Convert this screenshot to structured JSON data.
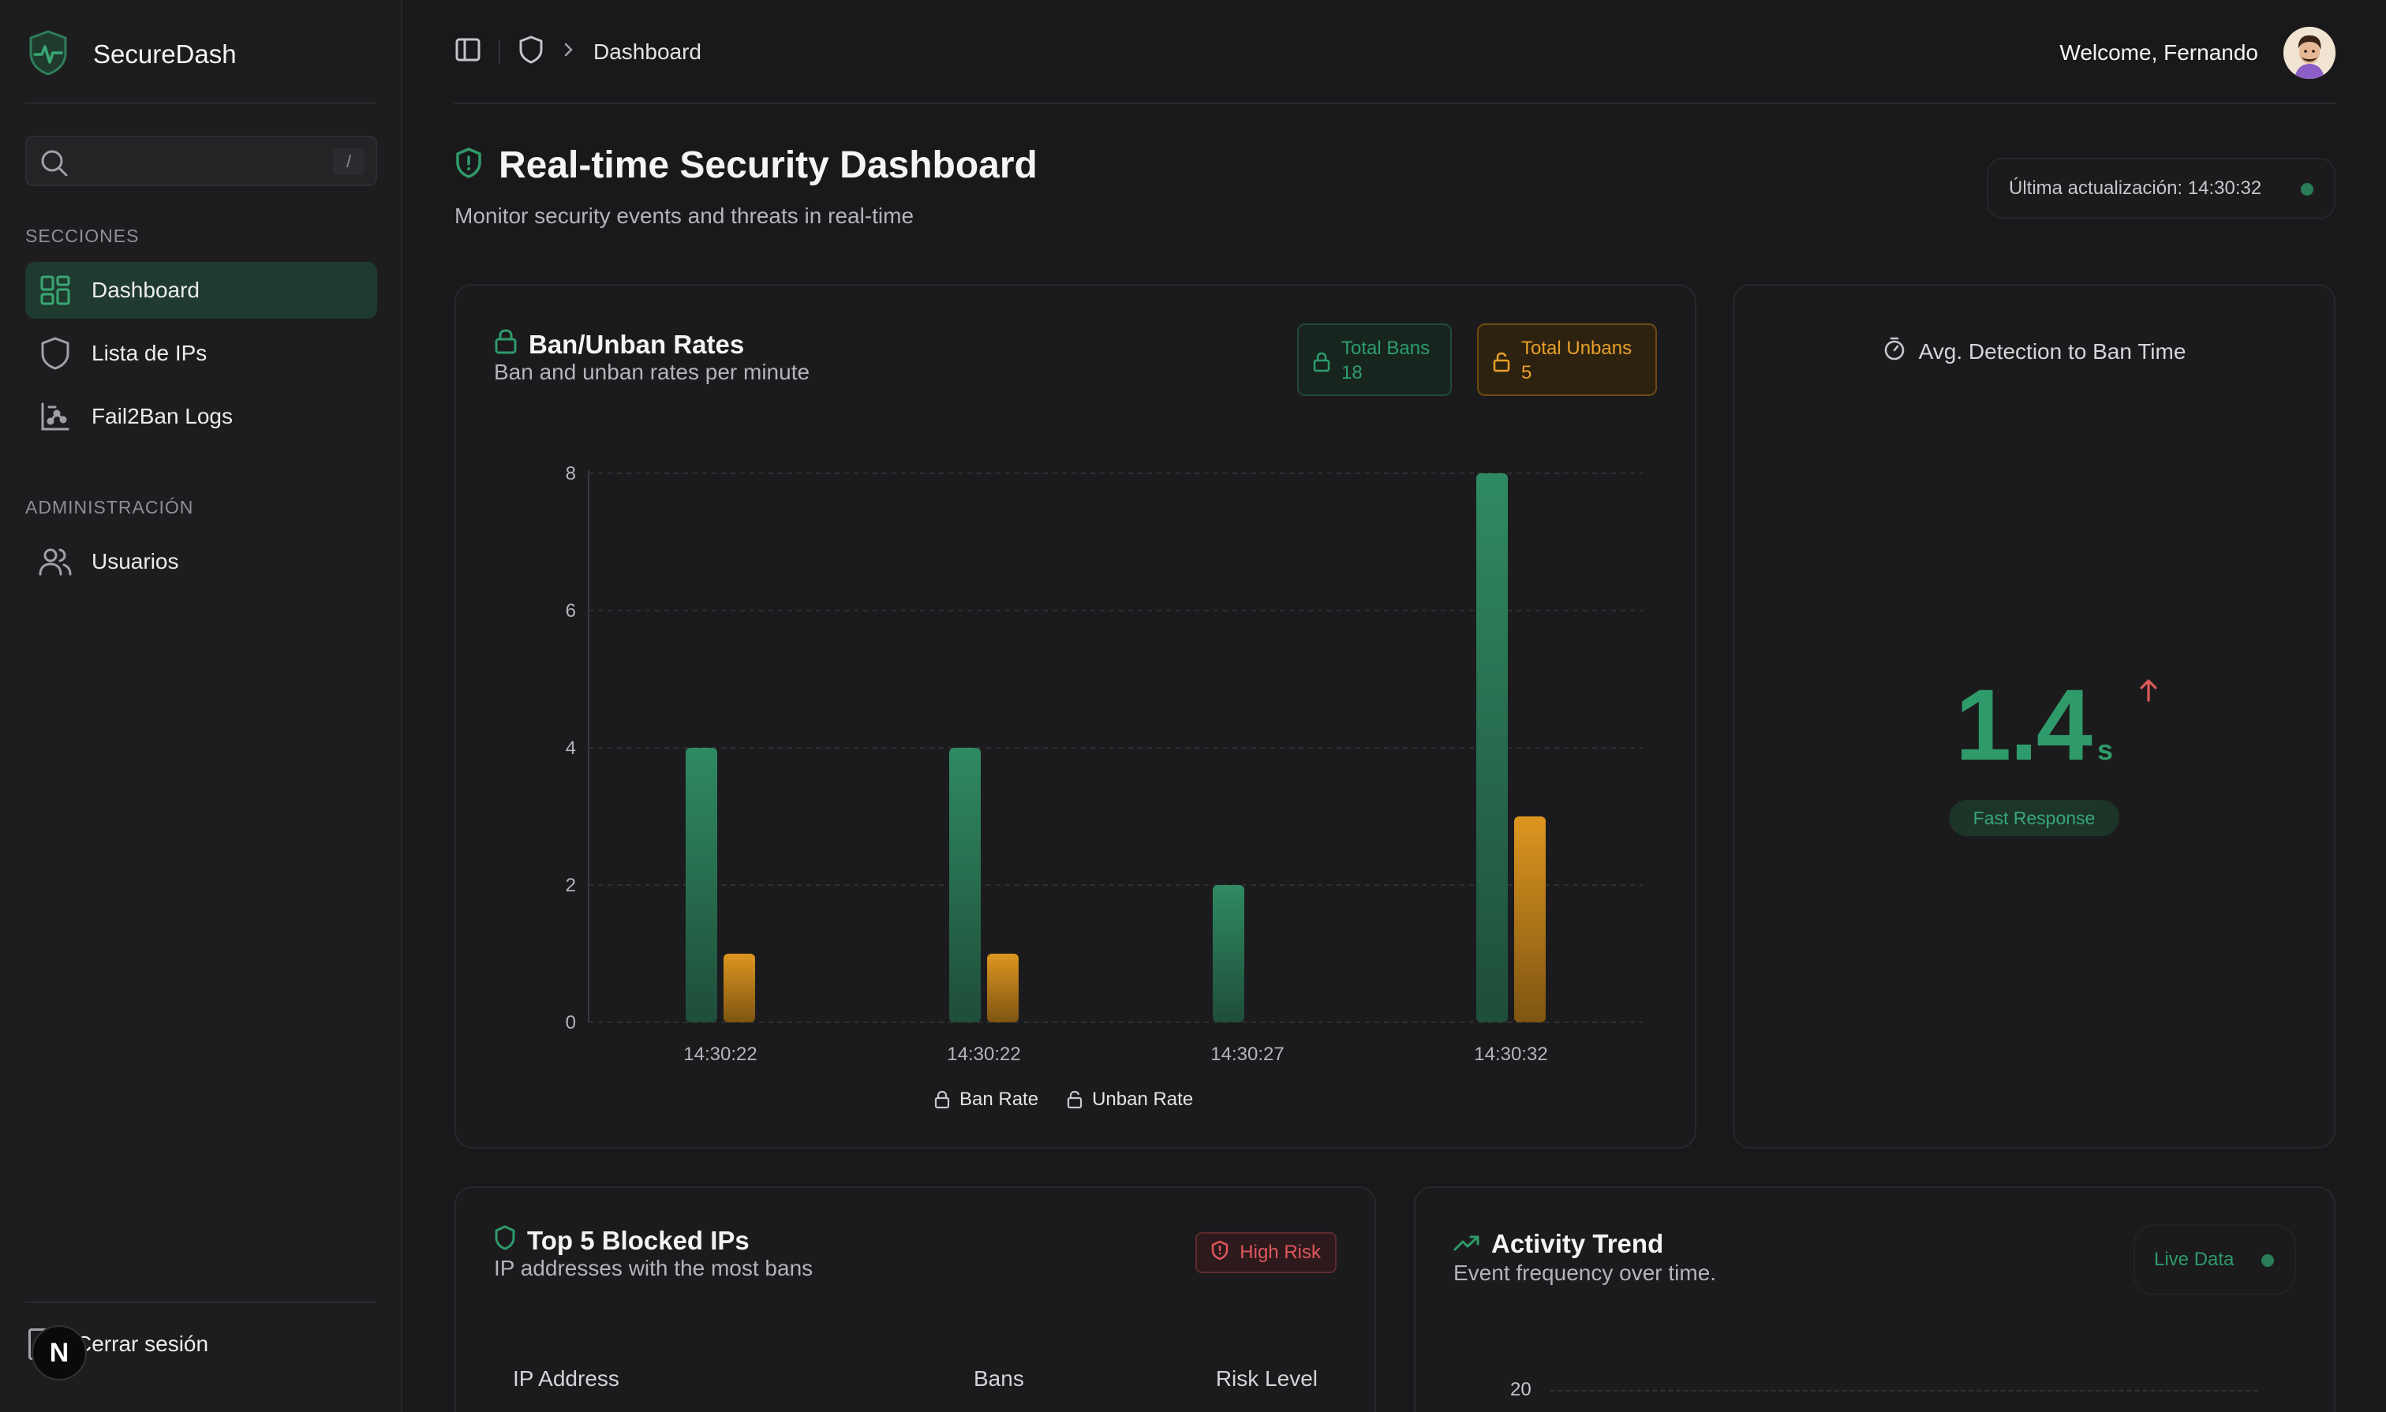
{
  "sidebar": {
    "brand": "SecureDash",
    "search": {
      "placeholder": "",
      "shortcut": "/"
    },
    "sections": [
      {
        "label": "SECCIONES",
        "items": [
          {
            "label": "Dashboard",
            "icon": "dashboard-grid-icon",
            "active": true
          },
          {
            "label": "Lista de IPs",
            "icon": "shield-icon",
            "active": false
          },
          {
            "label": "Fail2Ban Logs",
            "icon": "chart-logs-icon",
            "active": false
          }
        ]
      },
      {
        "label": "ADMINISTRACIÓN",
        "items": [
          {
            "label": "Usuarios",
            "icon": "users-icon",
            "active": false
          }
        ]
      }
    ],
    "logout": "Cerrar sesión",
    "next_badge": "N"
  },
  "header": {
    "breadcrumb": "Dashboard",
    "welcome": "Welcome, Fernando"
  },
  "page": {
    "title": "Real-time Security Dashboard",
    "subtitle": "Monitor security events and threats in real-time",
    "last_update": "Última actualización: 14:30:32"
  },
  "ban_card": {
    "title": "Ban/Unban Rates",
    "subtitle": "Ban and unban rates per minute",
    "total_bans_label": "Total Bans",
    "total_bans_value": "18",
    "total_unbans_label": "Total Unbans",
    "total_unbans_value": "5"
  },
  "avg_card": {
    "title": "Avg. Detection to Ban Time",
    "value": "1.4",
    "unit": "s",
    "badge": "Fast Response"
  },
  "blocked_card": {
    "title": "Top 5 Blocked IPs",
    "subtitle": "IP addresses with the most bans",
    "risk_badge": "High Risk",
    "columns": [
      "IP Address",
      "Bans",
      "Risk Level"
    ]
  },
  "trend_card": {
    "title": "Activity Trend",
    "subtitle": "Event frequency over time.",
    "badge": "Live Data",
    "y_tick_top": "20"
  },
  "colors": {
    "accent_green": "#2f8a62",
    "accent_amber": "#d8901c",
    "risk_red": "#e0575f"
  },
  "chart_data": {
    "type": "bar",
    "categories": [
      "14:30:22",
      "14:30:22",
      "14:30:27",
      "14:30:32"
    ],
    "series": [
      {
        "name": "Ban Rate",
        "values": [
          4,
          4,
          2,
          8
        ],
        "color": "#2f8a62"
      },
      {
        "name": "Unban Rate",
        "values": [
          1,
          1,
          0,
          3
        ],
        "color": "#d8901c"
      }
    ],
    "ylim": [
      0,
      8
    ],
    "yticks": [
      0,
      2,
      4,
      6,
      8
    ],
    "grid": true,
    "legend": "bottom"
  }
}
